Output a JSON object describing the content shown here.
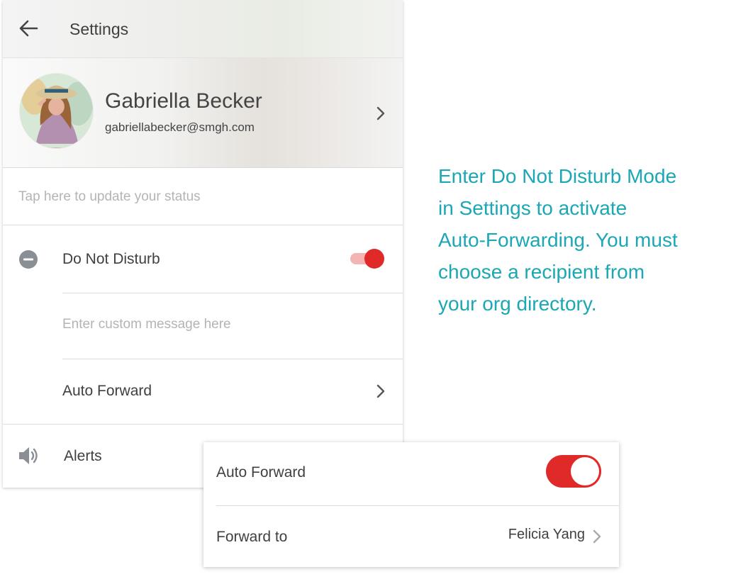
{
  "header": {
    "title": "Settings",
    "back_icon": "arrow-left-icon"
  },
  "profile": {
    "name": "Gabriella Becker",
    "email": "gabriellabecker@smgh.com",
    "chevron_icon": "chevron-right-icon"
  },
  "status": {
    "placeholder": "Tap here to update your status"
  },
  "do_not_disturb": {
    "label": "Do Not Disturb",
    "icon": "minus-circle-icon",
    "enabled": true,
    "custom_message_placeholder": "Enter custom message here"
  },
  "auto_forward_row": {
    "label": "Auto Forward",
    "chevron_icon": "chevron-right-icon"
  },
  "alerts_row": {
    "label": "Alerts",
    "icon": "speaker-icon"
  },
  "caption": {
    "line1": "Enter Do Not Disturb Mode",
    "line2": "in Settings to activate",
    "line3": "Auto-Forwarding. You must",
    "line4": "choose a recipient from",
    "line5": "your org directory."
  },
  "auto_forward_card": {
    "toggle_label": "Auto Forward",
    "enabled": true,
    "forward_to_label": "Forward to",
    "forward_to_value": "Felicia Yang",
    "chevron_icon": "chevron-right-icon"
  },
  "colors": {
    "accent_red": "#e02a2a",
    "caption_teal": "#1ba7b4",
    "toggle_track_light": "#f4b4b4"
  }
}
